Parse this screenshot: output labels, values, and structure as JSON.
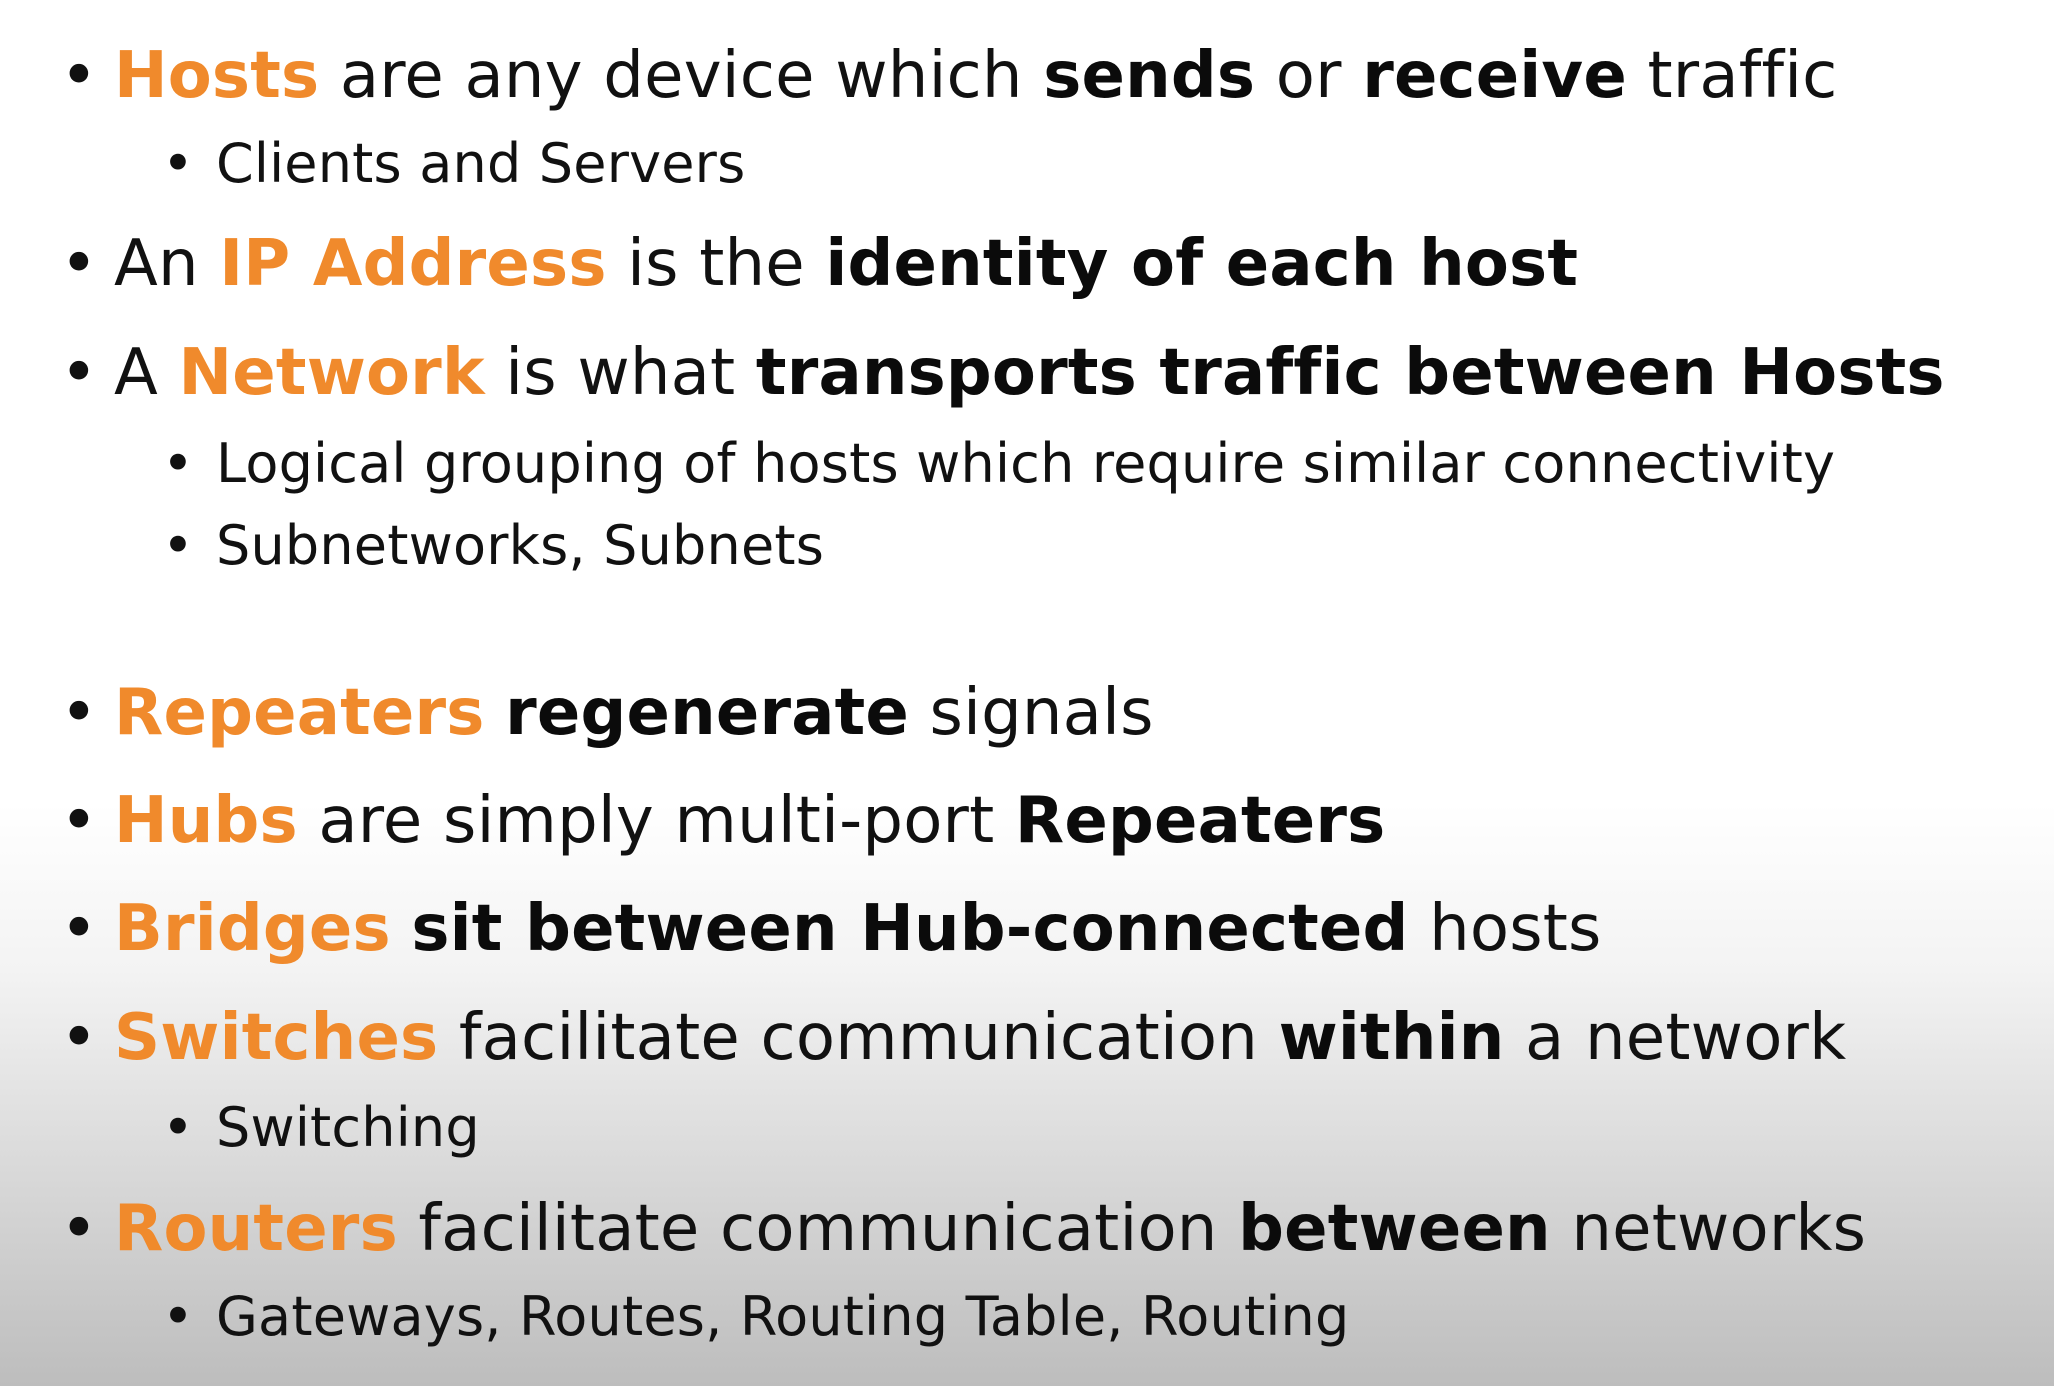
{
  "bullet_char": "•",
  "colors": {
    "highlight": "#f08a2c",
    "text": "#111111"
  },
  "items": [
    {
      "level": 1,
      "segments": [
        {
          "text": "Hosts",
          "style": "hl"
        },
        {
          "text": " are any device which ",
          "style": "normal"
        },
        {
          "text": "sends",
          "style": "strong"
        },
        {
          "text": " or ",
          "style": "normal"
        },
        {
          "text": "receive",
          "style": "strong"
        },
        {
          "text": " traffic",
          "style": "normal"
        }
      ]
    },
    {
      "level": 2,
      "segments": [
        {
          "text": "Clients and Servers",
          "style": "normal"
        }
      ]
    },
    {
      "level": 1,
      "segments": [
        {
          "text": "An ",
          "style": "normal"
        },
        {
          "text": "IP Address",
          "style": "hl"
        },
        {
          "text": " is the ",
          "style": "normal"
        },
        {
          "text": "identity of each host",
          "style": "strong"
        }
      ]
    },
    {
      "level": 1,
      "segments": [
        {
          "text": "A ",
          "style": "normal"
        },
        {
          "text": "Network",
          "style": "hl"
        },
        {
          "text": " is what ",
          "style": "normal"
        },
        {
          "text": "transports traffic between Hosts",
          "style": "strong"
        }
      ]
    },
    {
      "level": 2,
      "segments": [
        {
          "text": "Logical grouping of hosts which require similar connectivity",
          "style": "normal"
        }
      ]
    },
    {
      "level": 2,
      "segments": [
        {
          "text": "Subnetworks, Subnets",
          "style": "normal"
        }
      ]
    },
    {
      "level": 1,
      "segments": [
        {
          "text": "Repeaters",
          "style": "hl"
        },
        {
          "text": " ",
          "style": "normal"
        },
        {
          "text": "regenerate",
          "style": "strong"
        },
        {
          "text": " signals",
          "style": "normal"
        }
      ]
    },
    {
      "level": 1,
      "segments": [
        {
          "text": "Hubs",
          "style": "hl"
        },
        {
          "text": " are simply multi-port ",
          "style": "normal"
        },
        {
          "text": "Repeaters",
          "style": "strong"
        }
      ]
    },
    {
      "level": 1,
      "segments": [
        {
          "text": "Bridges",
          "style": "hl"
        },
        {
          "text": " ",
          "style": "normal"
        },
        {
          "text": "sit between Hub-connected",
          "style": "strong"
        },
        {
          "text": " hosts",
          "style": "normal"
        }
      ]
    },
    {
      "level": 1,
      "segments": [
        {
          "text": "Switches",
          "style": "hl"
        },
        {
          "text": " facilitate communication ",
          "style": "normal"
        },
        {
          "text": "within",
          "style": "strong"
        },
        {
          "text": " a network",
          "style": "normal"
        }
      ]
    },
    {
      "level": 2,
      "segments": [
        {
          "text": "Switching",
          "style": "normal"
        }
      ]
    },
    {
      "level": 1,
      "segments": [
        {
          "text": "Routers",
          "style": "hl"
        },
        {
          "text": " facilitate communication ",
          "style": "normal"
        },
        {
          "text": "between",
          "style": "strong"
        },
        {
          "text": " networks",
          "style": "normal"
        }
      ]
    },
    {
      "level": 2,
      "segments": [
        {
          "text": "Gateways, Routes, Routing Table, Routing",
          "style": "normal"
        }
      ]
    }
  ]
}
